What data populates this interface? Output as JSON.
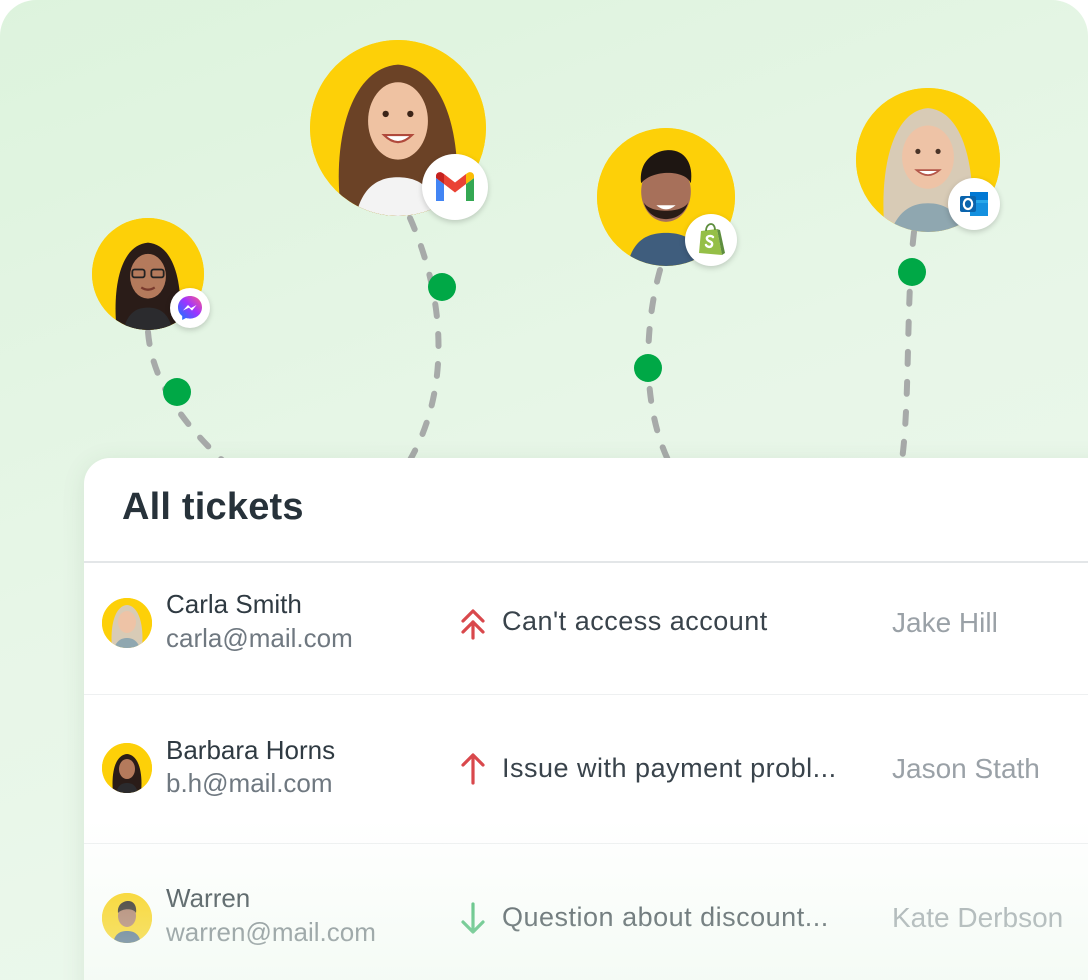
{
  "panel": {
    "title": "All tickets"
  },
  "tickets": [
    {
      "name": "Carla Smith",
      "email": "carla@mail.com",
      "priority": "urgent",
      "priority_icon": "double-chevron-up-icon",
      "subject": "Can't access account",
      "assignee": "Jake Hill"
    },
    {
      "name": "Barbara Horns",
      "email": "b.h@mail.com",
      "priority": "high",
      "priority_icon": "arrow-up-icon",
      "subject": "Issue with payment probl...",
      "assignee": "Jason Stath"
    },
    {
      "name": "Warren",
      "email": "warren@mail.com",
      "priority": "low",
      "priority_icon": "arrow-down-icon",
      "subject": "Question about discount...",
      "assignee": "Kate Derbson"
    }
  ],
  "channels": [
    {
      "icon": "messenger-icon"
    },
    {
      "icon": "gmail-icon"
    },
    {
      "icon": "shopify-icon"
    },
    {
      "icon": "outlook-icon"
    }
  ],
  "colors": {
    "avatar_bg": "#fdd008",
    "connector_dot": "#00a846",
    "connector_line": "#a7aaa9",
    "priority_high": "#d9484c",
    "priority_low": "#3bb56a",
    "background": "#e3f5e4"
  }
}
